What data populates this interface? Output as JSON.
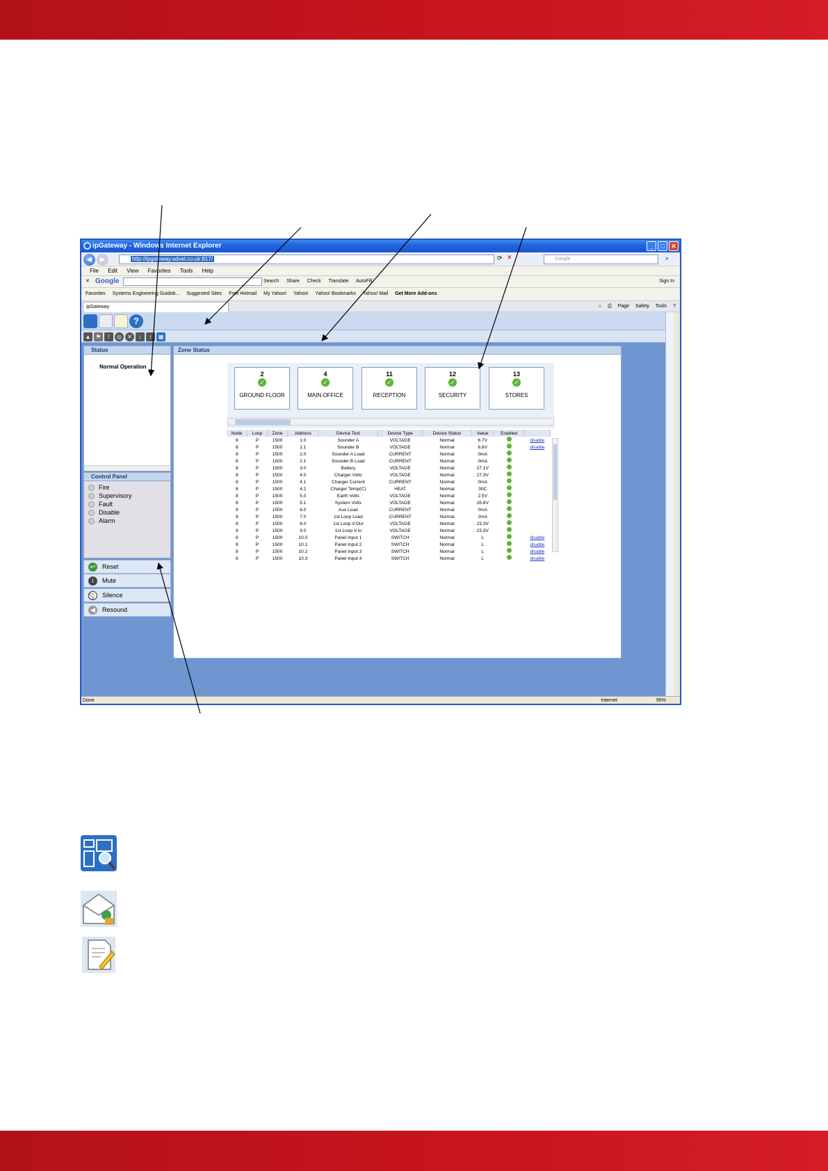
{
  "window": {
    "title": "ipGateway - Windows Internet Explorer",
    "address_url": "http://ipgateway.advel.co.uk:817/",
    "search_placeholder": "Google",
    "menu": [
      "File",
      "Edit",
      "View",
      "Favorites",
      "Tools",
      "Help"
    ],
    "google_bar": {
      "logo": "Google",
      "tools": [
        "Search",
        "Share",
        "Check",
        "Translate",
        "AutoFill"
      ],
      "sign_in": "Sign In"
    },
    "favorites": [
      "Favorites",
      "Systems Engineering Guidob...",
      "Suggested Sites",
      "Free Hotmail",
      "My Yahoo!",
      "Yahoo!",
      "Yahoo! Bookmarks",
      "Yahoo! Mail",
      "Get More Add-ons"
    ],
    "tab_label": "ipGateway",
    "command_bar": [
      "Page",
      "Safety",
      "Tools"
    ],
    "status_text": "Done",
    "zone_text": "Internet",
    "zoom": "95%"
  },
  "app": {
    "status_panel": {
      "title": "Status",
      "message": "Normal Operation"
    },
    "control_panel": {
      "title": "Control Panel",
      "indicators": [
        "Fire",
        "Supervisory",
        "Fault",
        "Disable",
        "Alarm"
      ]
    },
    "actions": [
      "Reset",
      "Mute",
      "Silence",
      "Resound"
    ],
    "zone_panel": {
      "title": "Zone Status"
    },
    "zones": [
      {
        "number": "2",
        "name": "GROUND FLOOR"
      },
      {
        "number": "4",
        "name": "MAIN OFFICE"
      },
      {
        "number": "11",
        "name": "RECEPTION"
      },
      {
        "number": "12",
        "name": "SECURITY"
      },
      {
        "number": "13",
        "name": "STORES"
      }
    ],
    "device_table": {
      "columns": [
        "Node",
        "Loop",
        "Zone",
        "Address",
        "Device Text",
        "Device Type",
        "Device Status",
        "Value",
        "Enabled",
        ""
      ],
      "rows": [
        [
          "8",
          "P",
          "1500",
          "1.0",
          "Sounder A",
          "VOLTAGE",
          "Normal",
          "6.7V",
          "disable"
        ],
        [
          "8",
          "P",
          "1500",
          "1.1",
          "Sounder B",
          "VOLTAGE",
          "Normal",
          "6.8V",
          "disable"
        ],
        [
          "8",
          "P",
          "1500",
          "2.0",
          "Sounder A Load",
          "CURRENT",
          "Normal",
          "0mA",
          ""
        ],
        [
          "8",
          "P",
          "1500",
          "2.1",
          "Sounder B Load",
          "CURRENT",
          "Normal",
          "0mA",
          ""
        ],
        [
          "8",
          "P",
          "1500",
          "3.0",
          "Battery",
          "VOLTAGE",
          "Normal",
          "27.1V",
          ""
        ],
        [
          "8",
          "P",
          "1500",
          "4.0",
          "Charger Volts",
          "VOLTAGE",
          "Normal",
          "27.3V",
          ""
        ],
        [
          "8",
          "P",
          "1500",
          "4.1",
          "Charger Current",
          "CURRENT",
          "Normal",
          "0mA",
          ""
        ],
        [
          "8",
          "P",
          "1500",
          "4.2",
          "Charger Temp(C)",
          "HEAT",
          "Normal",
          "30C",
          ""
        ],
        [
          "8",
          "P",
          "1500",
          "5.0",
          "Earth Volts",
          "VOLTAGE",
          "Normal",
          "2.5V",
          ""
        ],
        [
          "8",
          "P",
          "1500",
          "5.1",
          "System Volts",
          "VOLTAGE",
          "Normal",
          "26.8V",
          ""
        ],
        [
          "8",
          "P",
          "1500",
          "6.0",
          "Aux Load",
          "CURRENT",
          "Normal",
          "0mA",
          ""
        ],
        [
          "8",
          "P",
          "1500",
          "7.0",
          "1st Loop Load",
          "CURRENT",
          "Normal",
          "2mA",
          ""
        ],
        [
          "8",
          "P",
          "1500",
          "8.0",
          "1st Loop V.Out",
          "VOLTAGE",
          "Normal",
          "23.3V",
          ""
        ],
        [
          "8",
          "P",
          "1500",
          "9.0",
          "1st Loop V.In",
          "VOLTAGE",
          "Normal",
          "23.3V",
          ""
        ],
        [
          "8",
          "P",
          "1500",
          "10.0",
          "Panel Input 1",
          "SWITCH",
          "Normal",
          "L",
          "disable"
        ],
        [
          "8",
          "P",
          "1500",
          "10.1",
          "Panel Input 2",
          "SWITCH",
          "Normal",
          "L",
          "disable"
        ],
        [
          "8",
          "P",
          "1500",
          "10.2",
          "Panel Input 3",
          "SWITCH",
          "Normal",
          "L",
          "disable"
        ],
        [
          "8",
          "P",
          "1500",
          "10.3",
          "Panel Input 4",
          "SWITCH",
          "Normal",
          "L",
          "disable"
        ]
      ]
    }
  },
  "colors": {
    "brand_band": "#c8141f",
    "app_background": "#6f96d0",
    "ok_green": "#5cb533"
  },
  "legend_icons": [
    "zone-map-icon",
    "email-settings-icon",
    "edit-document-icon"
  ]
}
